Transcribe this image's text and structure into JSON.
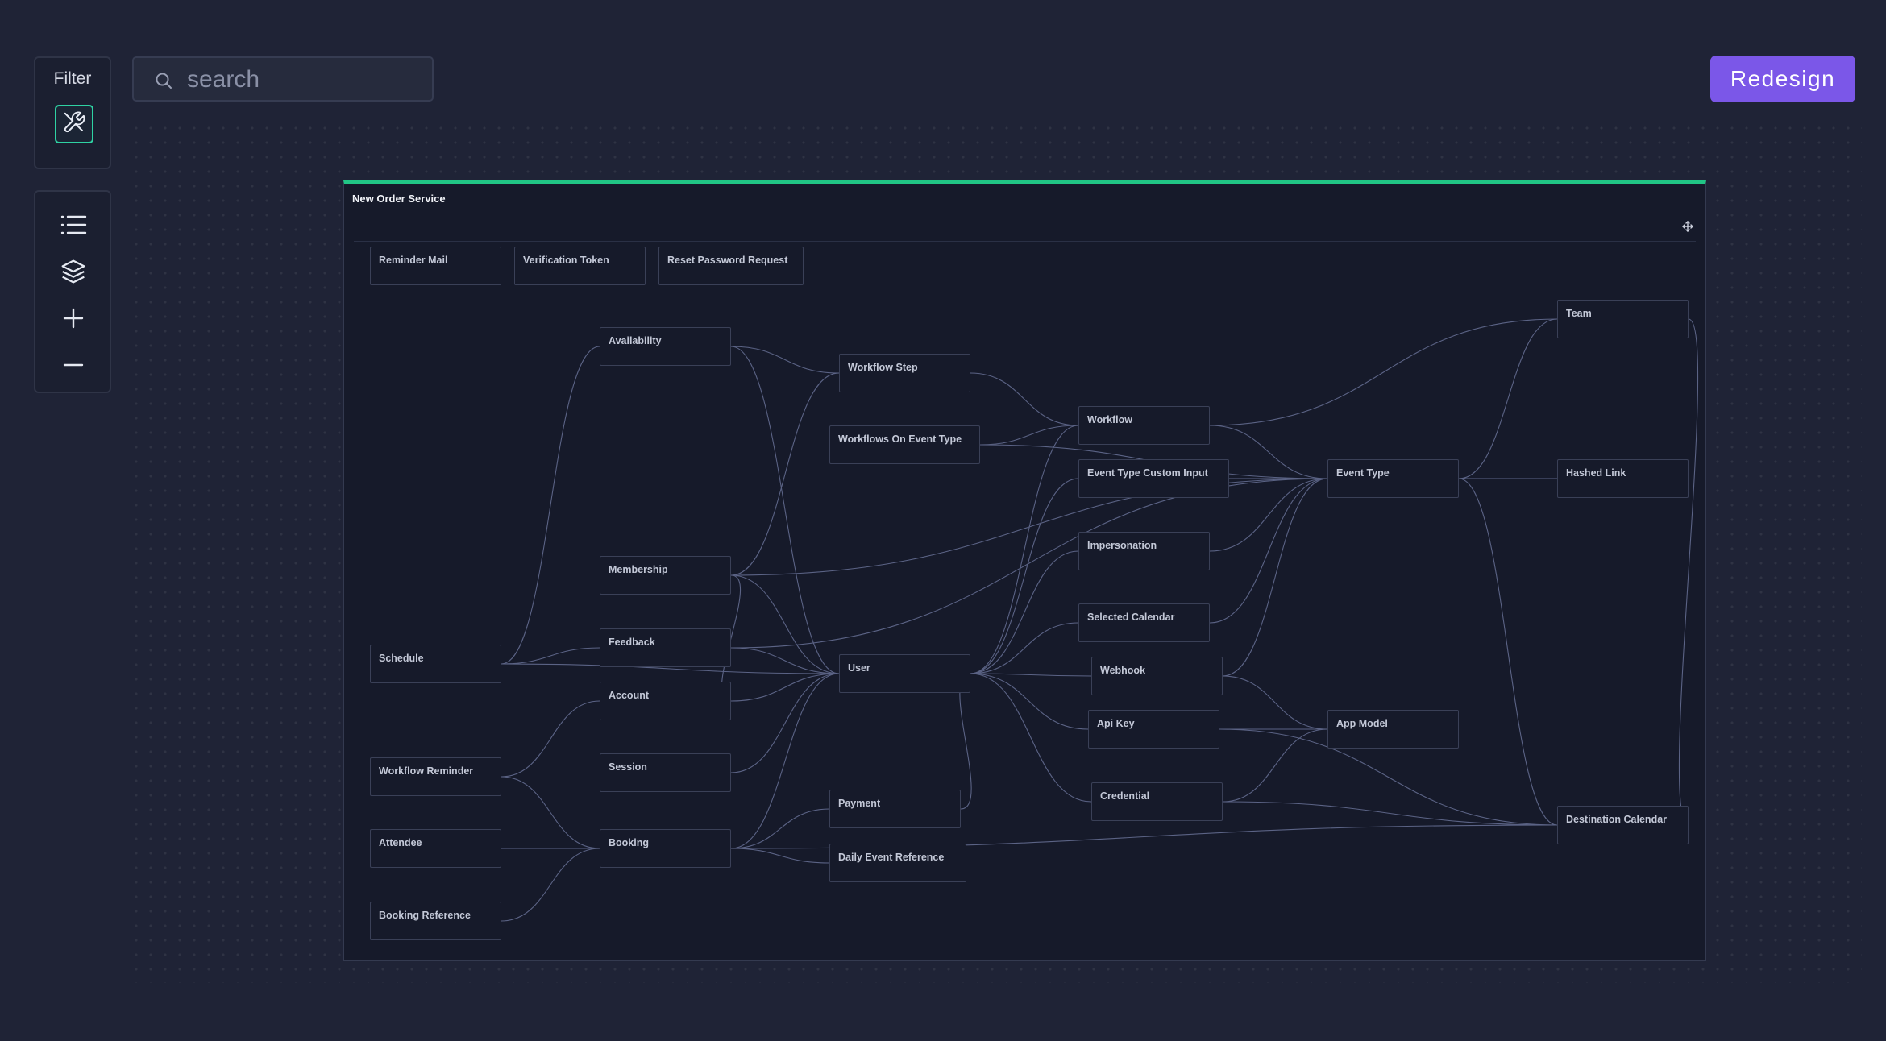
{
  "filter": {
    "label": "Filter",
    "icon": "tools-icon"
  },
  "search": {
    "placeholder": "search"
  },
  "toolbar": {
    "icons": [
      "list-icon",
      "layers-icon",
      "zoom-in-icon",
      "zoom-out-icon"
    ]
  },
  "actions": {
    "redesign_label": "Redesign"
  },
  "group": {
    "title": "New Order Service"
  },
  "entities": {
    "reminder_mail": "Reminder Mail",
    "verification_token": "Verification Token",
    "reset_password_request": "Reset Password Request",
    "availability": "Availability",
    "workflow_step": "Workflow Step",
    "workflows_on_event_type": "Workflows On Event Type",
    "workflow": "Workflow",
    "event_type_custom_input": "Event Type Custom Input",
    "event_type": "Event Type",
    "team": "Team",
    "hashed_link": "Hashed Link",
    "membership": "Membership",
    "impersonation": "Impersonation",
    "selected_calendar": "Selected Calendar",
    "schedule": "Schedule",
    "feedback": "Feedback",
    "user": "User",
    "webhook": "Webhook",
    "account": "Account",
    "api_key": "Api Key",
    "app_model": "App Model",
    "session": "Session",
    "workflow_reminder": "Workflow Reminder",
    "credential": "Credential",
    "payment": "Payment",
    "attendee": "Attendee",
    "booking": "Booking",
    "destination_calendar": "Destination Calendar",
    "daily_event_reference": "Daily Event Reference",
    "booking_reference": "Booking Reference"
  },
  "relations": [
    [
      "availability",
      "schedule"
    ],
    [
      "availability",
      "workflow_step"
    ],
    [
      "availability",
      "user"
    ],
    [
      "workflow_step",
      "membership"
    ],
    [
      "workflow_step",
      "workflow"
    ],
    [
      "workflows_on_event_type",
      "workflow"
    ],
    [
      "workflows_on_event_type",
      "event_type"
    ],
    [
      "workflow",
      "team"
    ],
    [
      "workflow",
      "user"
    ],
    [
      "workflow",
      "event_type"
    ],
    [
      "event_type_custom_input",
      "event_type"
    ],
    [
      "event_type",
      "team"
    ],
    [
      "event_type",
      "hashed_link"
    ],
    [
      "event_type",
      "destination_calendar"
    ],
    [
      "event_type",
      "webhook"
    ],
    [
      "event_type",
      "membership"
    ],
    [
      "event_type",
      "feedback"
    ],
    [
      "event_type",
      "selected_calendar"
    ],
    [
      "event_type",
      "impersonation"
    ],
    [
      "team",
      "destination_calendar"
    ],
    [
      "membership",
      "user"
    ],
    [
      "membership",
      "account"
    ],
    [
      "feedback",
      "user"
    ],
    [
      "schedule",
      "feedback"
    ],
    [
      "schedule",
      "user"
    ],
    [
      "account",
      "user"
    ],
    [
      "account",
      "workflow_reminder"
    ],
    [
      "session",
      "user"
    ],
    [
      "user",
      "impersonation"
    ],
    [
      "user",
      "selected_calendar"
    ],
    [
      "user",
      "webhook"
    ],
    [
      "user",
      "api_key"
    ],
    [
      "user",
      "credential"
    ],
    [
      "user",
      "booking"
    ],
    [
      "user",
      "payment"
    ],
    [
      "user",
      "event_type_custom_input"
    ],
    [
      "webhook",
      "app_model"
    ],
    [
      "api_key",
      "app_model"
    ],
    [
      "api_key",
      "destination_calendar"
    ],
    [
      "credential",
      "app_model"
    ],
    [
      "credential",
      "destination_calendar"
    ],
    [
      "workflow_reminder",
      "booking"
    ],
    [
      "attendee",
      "booking"
    ],
    [
      "booking_reference",
      "booking"
    ],
    [
      "booking",
      "payment"
    ],
    [
      "booking",
      "daily_event_reference"
    ],
    [
      "booking",
      "destination_calendar"
    ]
  ]
}
